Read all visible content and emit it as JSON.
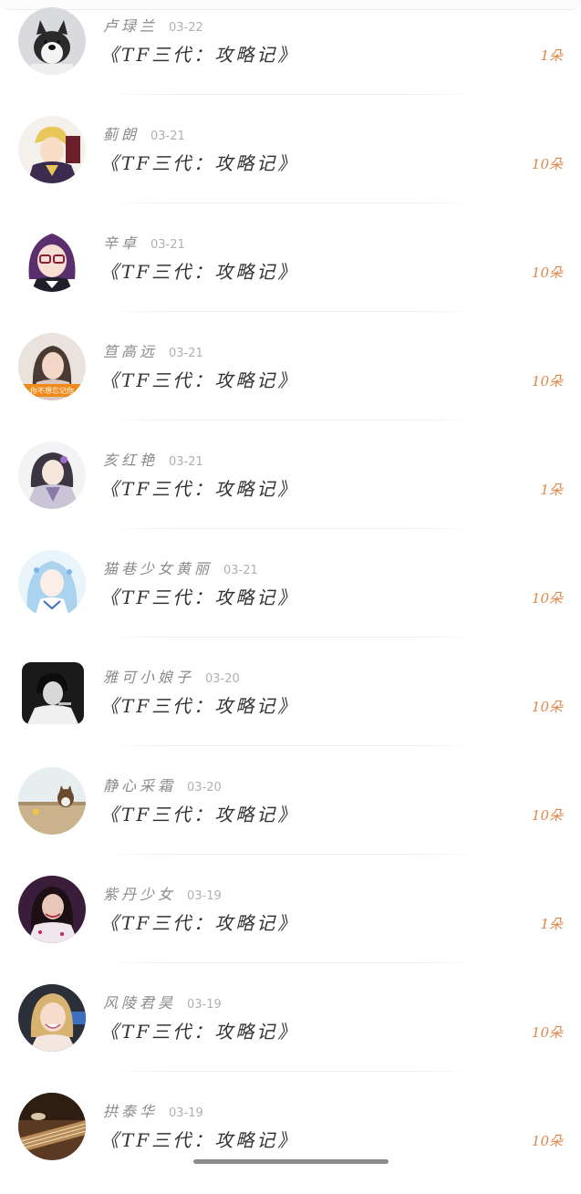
{
  "colors": {
    "title": "#333333",
    "name": "#8a8a8a",
    "date": "#b0b0b0",
    "gift": "#e0884a"
  },
  "items": [
    {
      "name": "卢琭兰",
      "date": "03-22",
      "title": "《TF三代：攻略记》",
      "gift": "1朵",
      "avatar": "husky-dog-avatar"
    },
    {
      "name": "蓟朗",
      "date": "03-21",
      "title": "《TF三代：攻略记》",
      "gift": "10朵",
      "avatar": "anime-blonde-avatar"
    },
    {
      "name": "辛卓",
      "date": "03-21",
      "title": "《TF三代：攻略记》",
      "gift": "10朵",
      "avatar": "anime-purple-hair-avatar"
    },
    {
      "name": "笪高远",
      "date": "03-21",
      "title": "《TF三代：攻略记》",
      "gift": "10朵",
      "avatar": "photo-woman-avatar",
      "avatar_caption": "你不想忘记你"
    },
    {
      "name": "亥红艳",
      "date": "03-21",
      "title": "《TF三代：攻略记》",
      "gift": "1朵",
      "avatar": "anime-robed-avatar"
    },
    {
      "name": "猫巷少女黄丽",
      "date": "03-21",
      "title": "《TF三代：攻略记》",
      "gift": "10朵",
      "avatar": "anime-blue-hair-avatar"
    },
    {
      "name": "雅可小娘子",
      "date": "03-20",
      "title": "《TF三代：攻略记》",
      "gift": "10朵",
      "avatar": "photo-bw-person-avatar"
    },
    {
      "name": "静心采霜",
      "date": "03-20",
      "title": "《TF三代：攻略记》",
      "gift": "10朵",
      "avatar": "photo-cat-avatar"
    },
    {
      "name": "紫丹少女",
      "date": "03-19",
      "title": "《TF三代：攻略记》",
      "gift": "1朵",
      "avatar": "photo-woman-dark-avatar"
    },
    {
      "name": "风陵君昊",
      "date": "03-19",
      "title": "《TF三代：攻略记》",
      "gift": "10朵",
      "avatar": "photo-blonde-girl-avatar"
    },
    {
      "name": "拱泰华",
      "date": "03-19",
      "title": "《TF三代：攻略记》",
      "gift": "10朵",
      "avatar": "photo-instrument-avatar"
    }
  ]
}
